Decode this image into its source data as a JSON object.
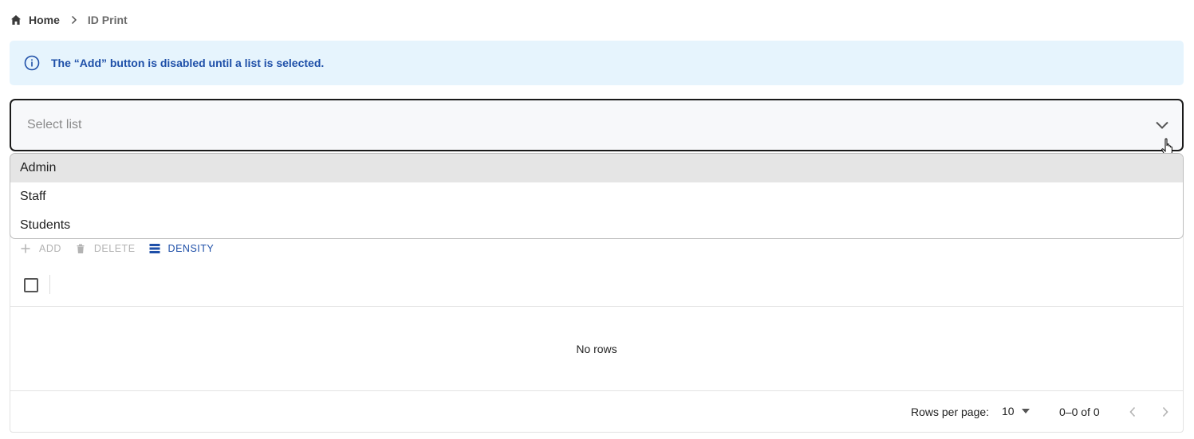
{
  "breadcrumb": {
    "home": "Home",
    "current": "ID Print"
  },
  "alert": {
    "message": "The “Add” button is disabled until a list is selected."
  },
  "select": {
    "placeholder": "Select list",
    "options": [
      "Admin",
      "Staff",
      "Students"
    ],
    "highlighted": "Admin"
  },
  "toolbar": {
    "add_label": "ADD",
    "delete_label": "DELETE",
    "density_label": "DENSITY"
  },
  "grid": {
    "empty_message": "No rows"
  },
  "pagination": {
    "rows_per_page_label": "Rows per page:",
    "rows_per_page_value": "10",
    "range": "0–0 of 0"
  },
  "colors": {
    "accent": "#1e4fa8",
    "alert_bg": "#e6f4fd",
    "disabled": "#b3b3b3"
  },
  "icons": {
    "home": "home-icon",
    "separator": "chevron-right-icon",
    "info": "info-icon",
    "dropdown": "chevron-down-icon",
    "add": "plus-icon",
    "delete": "trash-icon",
    "density": "density-icon",
    "prev": "chevron-left-icon",
    "next": "chevron-right-icon"
  }
}
